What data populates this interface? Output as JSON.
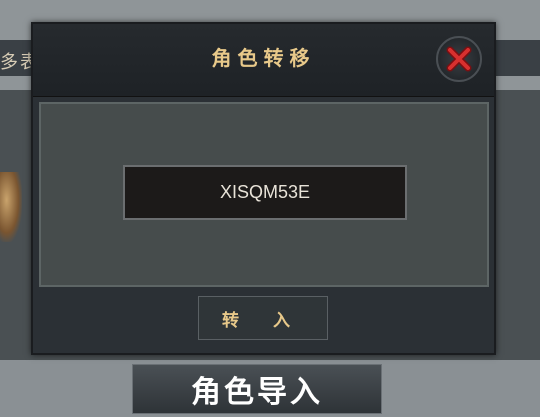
{
  "background": {
    "left_label": "多表"
  },
  "dialog": {
    "title": "角色转移",
    "code_value": "XISQM53E",
    "transfer_label": "转 入"
  },
  "import_button_label": "角色导入",
  "colors": {
    "title_gold": "#e8c98a",
    "close_red": "#c0282a"
  }
}
